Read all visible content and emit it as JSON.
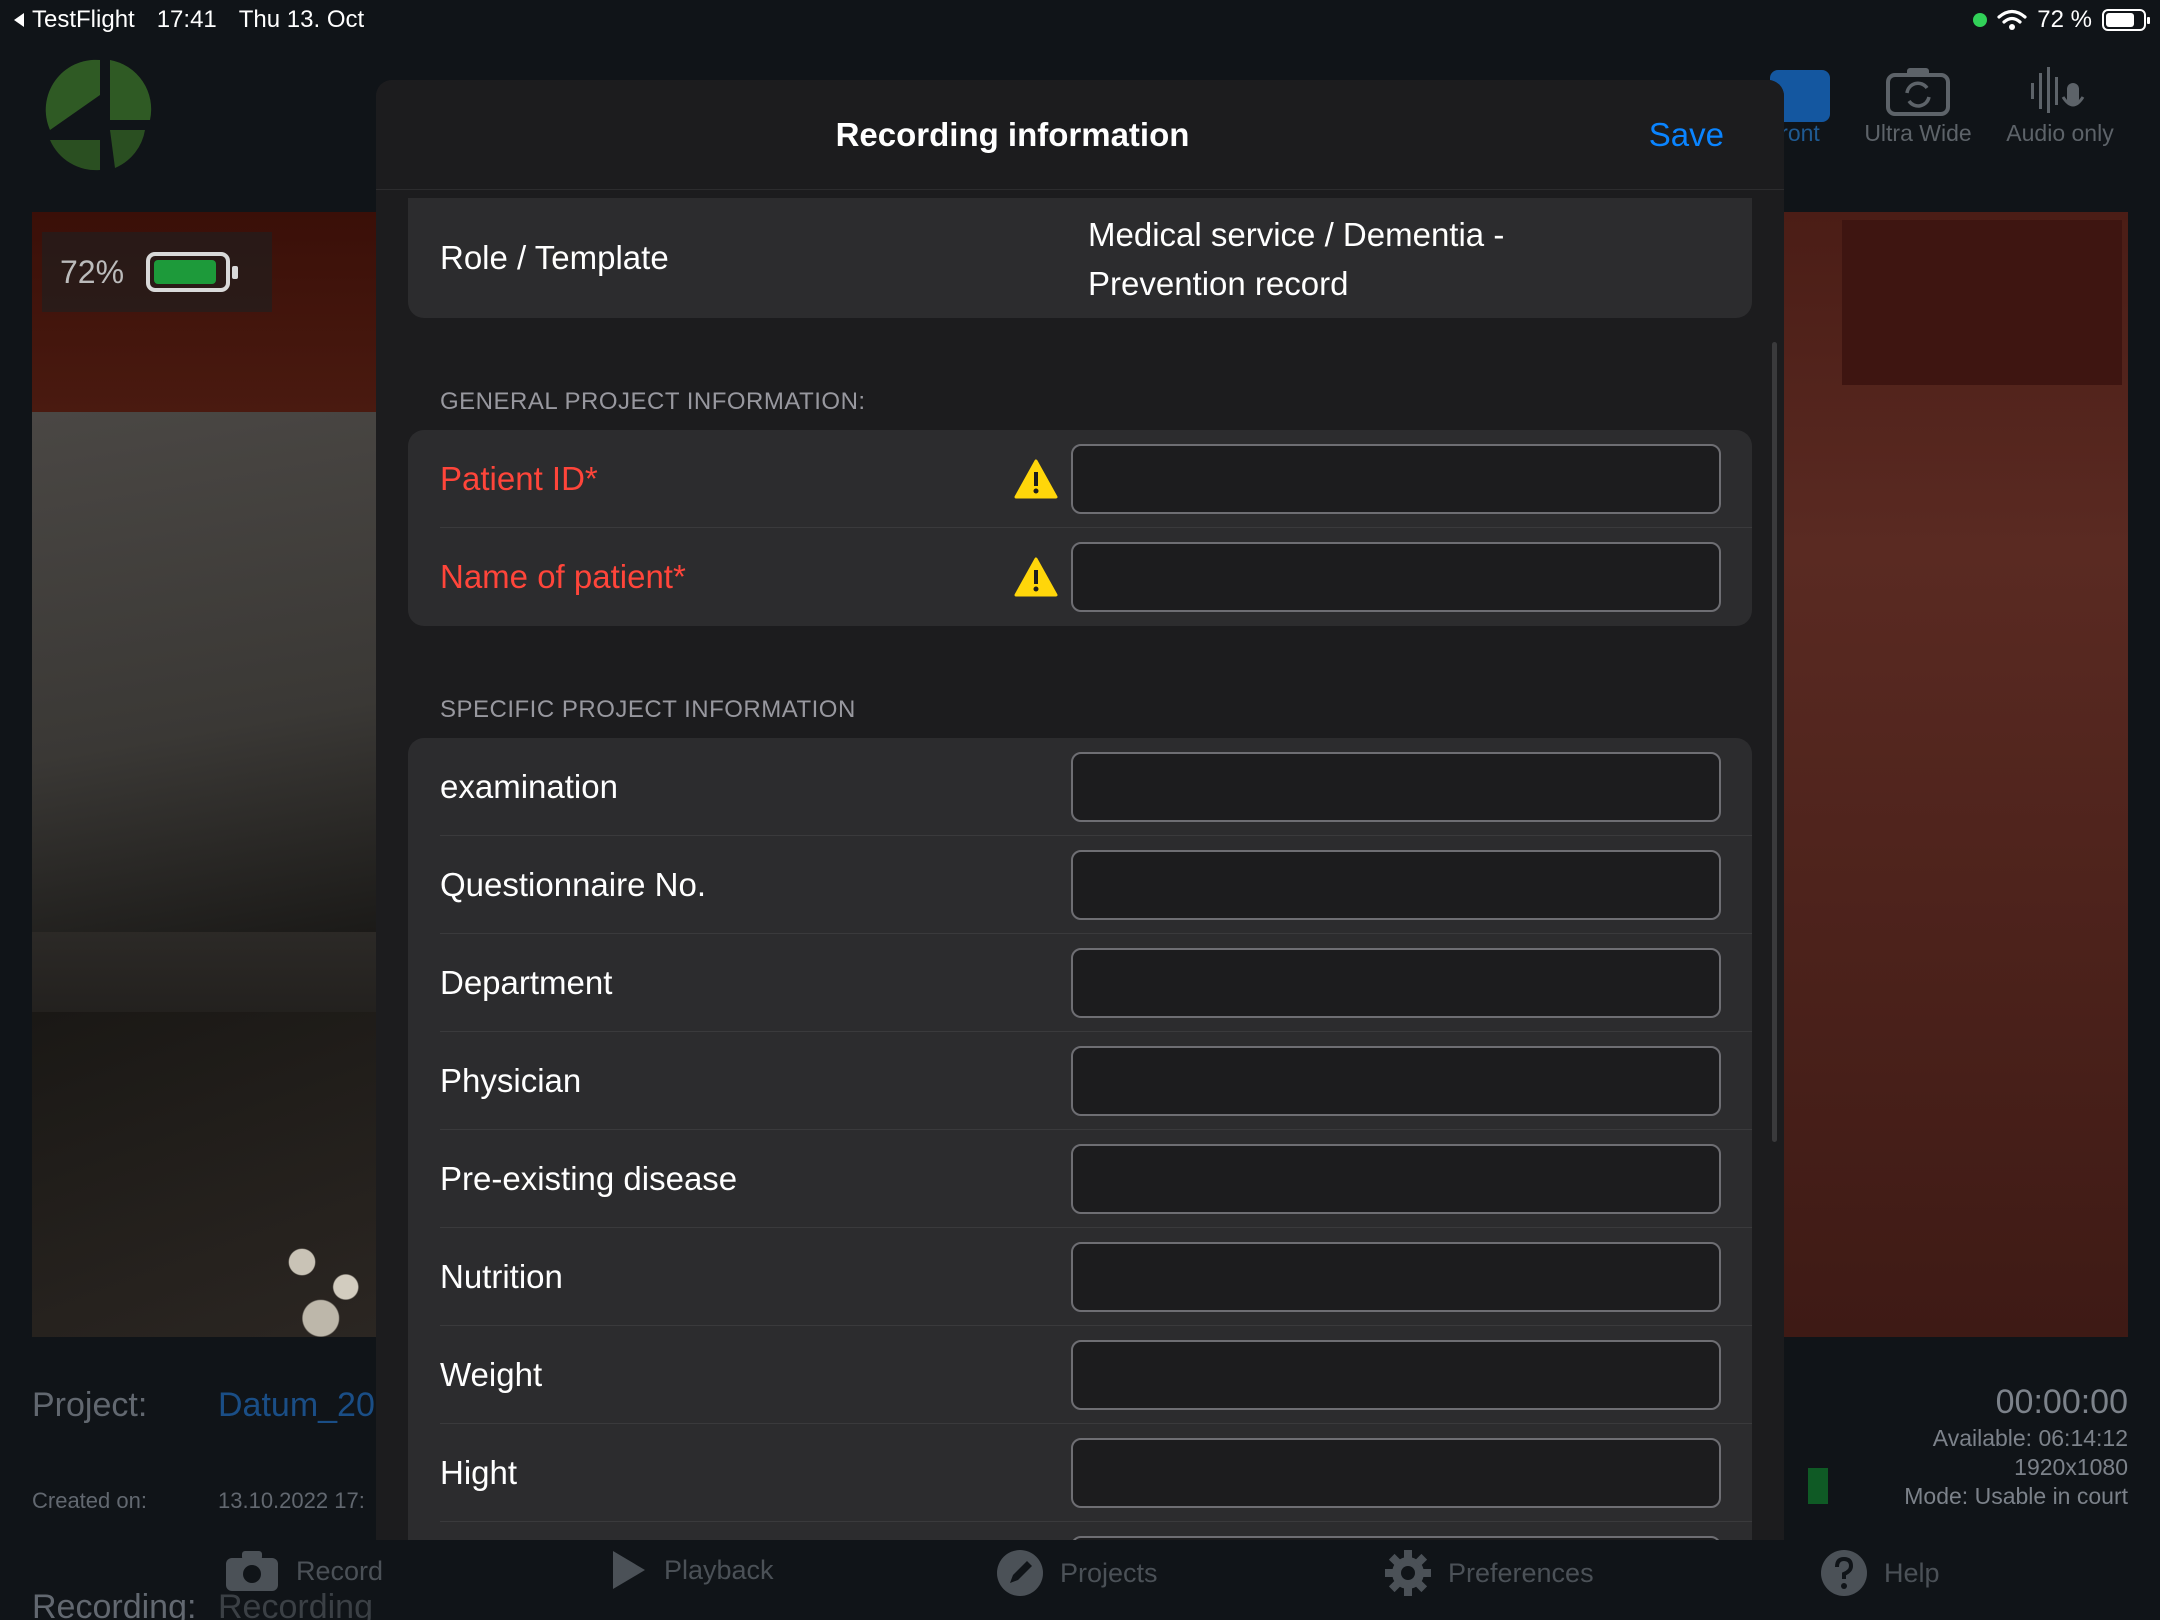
{
  "status_bar": {
    "back_app": "TestFlight",
    "time": "17:41",
    "date": "Thu 13. Oct",
    "battery": "72 %"
  },
  "camera": {
    "battery_overlay": "72%"
  },
  "top_tools": {
    "front_label": "ront",
    "ultra_wide_label": "Ultra Wide",
    "audio_only_label": "Audio only"
  },
  "project_info": {
    "project_key": "Project:",
    "project_value": "Datum_20",
    "created_key": "Created on:",
    "created_value": "13.10.2022 17:",
    "recording_key": "Recording:",
    "recording_value": "Recording"
  },
  "recording_status": {
    "timer": "00:00:00",
    "available": "Available: 06:14:12",
    "resolution": "1920x1080",
    "mode": "Mode: Usable in court"
  },
  "tab_bar": {
    "record": "Record",
    "playback": "Playback",
    "projects": "Projects",
    "preferences": "Preferences",
    "help": "Help"
  },
  "modal": {
    "title": "Recording information",
    "save_label": "Save",
    "role_template": {
      "label": "Role / Template",
      "value_line1": "Medical service / Dementia -",
      "value_line2": "Prevention record"
    },
    "general_section_label": "GENERAL PROJECT INFORMATION:",
    "general_fields": [
      {
        "label": "Patient ID*",
        "value": ""
      },
      {
        "label": "Name of patient*",
        "value": ""
      }
    ],
    "specific_section_label": "SPECIFIC PROJECT INFORMATION",
    "specific_fields": [
      {
        "label": "examination",
        "value": ""
      },
      {
        "label": "Questionnaire No.",
        "value": ""
      },
      {
        "label": "Department",
        "value": ""
      },
      {
        "label": "Physician",
        "value": ""
      },
      {
        "label": "Pre-existing disease",
        "value": ""
      },
      {
        "label": "Nutrition",
        "value": ""
      },
      {
        "label": "Weight",
        "value": ""
      },
      {
        "label": "Hight",
        "value": ""
      }
    ]
  },
  "colors": {
    "accent": "#0a84ff",
    "required": "#ff453a",
    "warning": "#ffd60a",
    "modal_bg": "#1c1c1e",
    "group_bg": "#2c2c2e"
  },
  "icons": {
    "back": "chevron-left-icon",
    "wifi": "wifi-icon",
    "warning": "warning-triangle-icon",
    "camera_flip": "camera-flip-icon",
    "audio": "microphone-wave-icon",
    "record": "camera-icon",
    "playback": "play-icon",
    "projects": "pencil-icon",
    "preferences": "gear-icon",
    "help": "question-icon"
  }
}
